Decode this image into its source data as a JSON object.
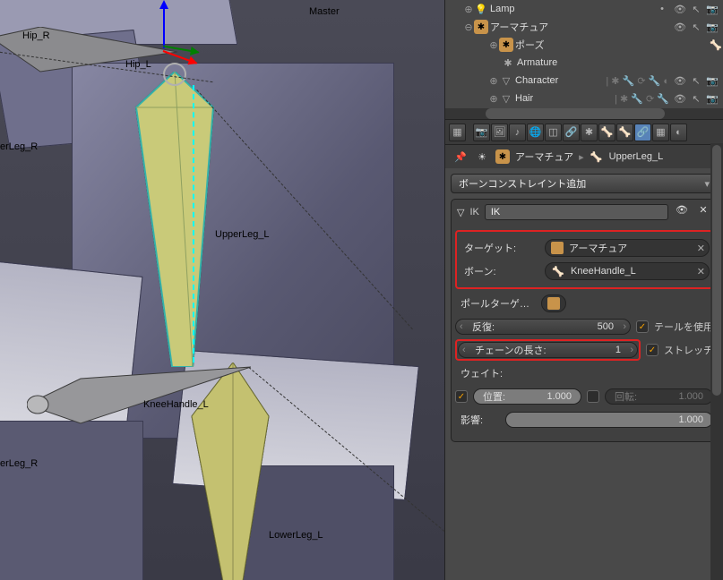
{
  "viewport": {
    "labels": {
      "master": "Master",
      "hip_r": "Hip_R",
      "hip_l": "Hip_L",
      "upperleg_l": "UpperLeg_L",
      "kneehandle_l": "KneeHandle_L",
      "lowerleg_l": "LowerLeg_L",
      "lowerleg_r_a": "erLeg_R",
      "lowerleg_r_b": "erLeg_R"
    }
  },
  "outliner": {
    "rows": [
      {
        "label": "Lamp",
        "icon": "lamp"
      },
      {
        "label": "アーマチュア",
        "icon": "arm"
      },
      {
        "label": "ポーズ",
        "icon": "pose"
      },
      {
        "label": "Armature",
        "icon": "amt"
      },
      {
        "label": "Character",
        "icon": "mesh"
      },
      {
        "label": "Hair",
        "icon": "mesh"
      }
    ]
  },
  "breadcrumb": {
    "armature": "アーマチュア",
    "bone": "UpperLeg_L"
  },
  "constraints": {
    "add_label": "ボーンコンストレイント追加",
    "ik": {
      "type": "IK",
      "name": "IK",
      "target_label": "ターゲット:",
      "target_value": "アーマチュア",
      "bone_label": "ボーン:",
      "bone_value": "KneeHandle_L",
      "pole_label": "ポールターゲ…",
      "iter_label": "反復:",
      "iter_value": "500",
      "usetail_label": "テールを使用",
      "chain_label": "チェーンの長さ:",
      "chain_value": "1",
      "stretch_label": "ストレッチ",
      "weight_label": "ウェイト:",
      "pos_label": "位置:",
      "pos_value": "1.000",
      "rot_label": "回転:",
      "rot_value": "1.000",
      "influence_label": "影響:",
      "influence_value": "1.000"
    }
  }
}
